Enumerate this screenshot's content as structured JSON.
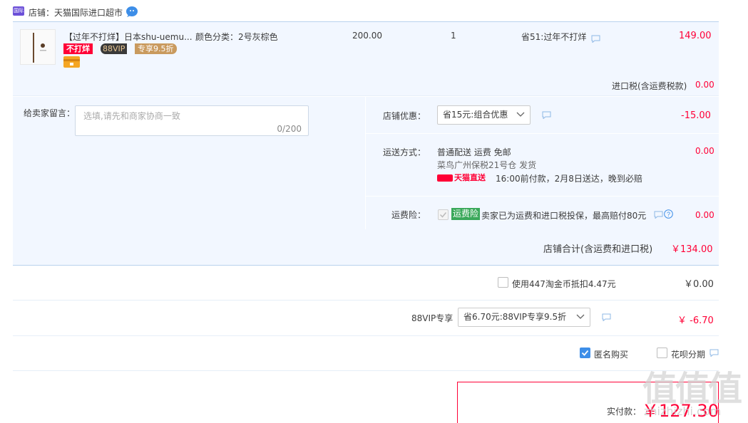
{
  "shop": {
    "label": "店铺：天猫国际进口超市",
    "badge_text": "国际"
  },
  "item": {
    "title": "【过年不打烊】日本shu-uemu...",
    "sku": "颜色分类：2号灰棕色",
    "price": "200.00",
    "qty": "1",
    "promo": "省51:过年不打烊",
    "total": "149.00",
    "tag_red": "不打烊",
    "tag_vip": "88VIP",
    "tag_vip_discount": "专享9.5折"
  },
  "import_tax": {
    "label": "进口税(含运费税款)",
    "value": "0.00"
  },
  "message": {
    "label": "给卖家留言：",
    "placeholder": "选填,请先和商家协商一致",
    "counter": "0/200"
  },
  "shop_discount": {
    "label": "店铺优惠：",
    "selected": "省15元:组合优惠",
    "value": "-15.00"
  },
  "shipping": {
    "label": "运送方式：",
    "method": "普通配送 运费 免邮",
    "warehouse": "菜鸟广州保税21号仓  发货",
    "badge": "天猫直送",
    "delivery": "16:00前付款，2月8日送达，晚到必赔",
    "value": "0.00"
  },
  "insurance": {
    "label": "运费险：",
    "tag": "运费险",
    "text": "卖家已为运费和进口税投保，最高赔付80元",
    "value": "0.00"
  },
  "shop_total": {
    "label": "店铺合计(含运费和进口税)",
    "value": "￥134.00"
  },
  "coins": {
    "label": "使用447淘金币抵扣4.47元",
    "value": "￥0.00"
  },
  "vip": {
    "label": "88VIP专享",
    "selected": "省6.70元:88VIP专享9.5折",
    "value": "￥ -6.70"
  },
  "anonymous": {
    "label": "匿名购买"
  },
  "huabei": {
    "label": "花呗分期"
  },
  "payment": {
    "label": "实付款：",
    "value": "￥127.30"
  },
  "watermark": "值值值",
  "watermark_url": "zhizhizhi.com",
  "colors": {
    "accent": "#ff0036",
    "blue": "#3d8ee8",
    "bg": "#f2f7ff",
    "green": "#3aa85a"
  }
}
